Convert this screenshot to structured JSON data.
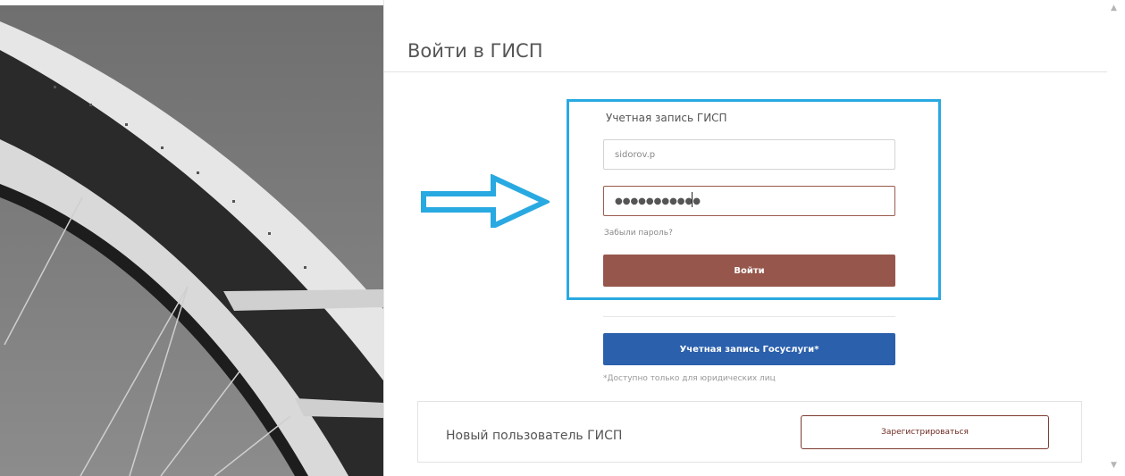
{
  "header": {
    "title": "Войти в ГИСП"
  },
  "login": {
    "section_label": "Учетная запись ГИСП",
    "username_value": "sidorov.p",
    "password_mask": "●●●●●●●●●●●",
    "forgot_password": "Забыли пароль?",
    "login_button": "Войти"
  },
  "gosuslugi": {
    "button": "Учетная запись Госуслуги*",
    "note": "*Доступно только для юридических лиц"
  },
  "register": {
    "label": "Новый пользователь ГИСП",
    "button": "Зарегистрироваться"
  },
  "annotation": {
    "highlight_color": "#29a9e1",
    "arrow_color": "#29a9e1"
  },
  "colors": {
    "login_button": "#96564b",
    "gosuslugi_button": "#2b60ac",
    "register_border": "#7d3a30"
  },
  "icons": {
    "scroll_up": "▲",
    "scroll_down": "▼"
  }
}
